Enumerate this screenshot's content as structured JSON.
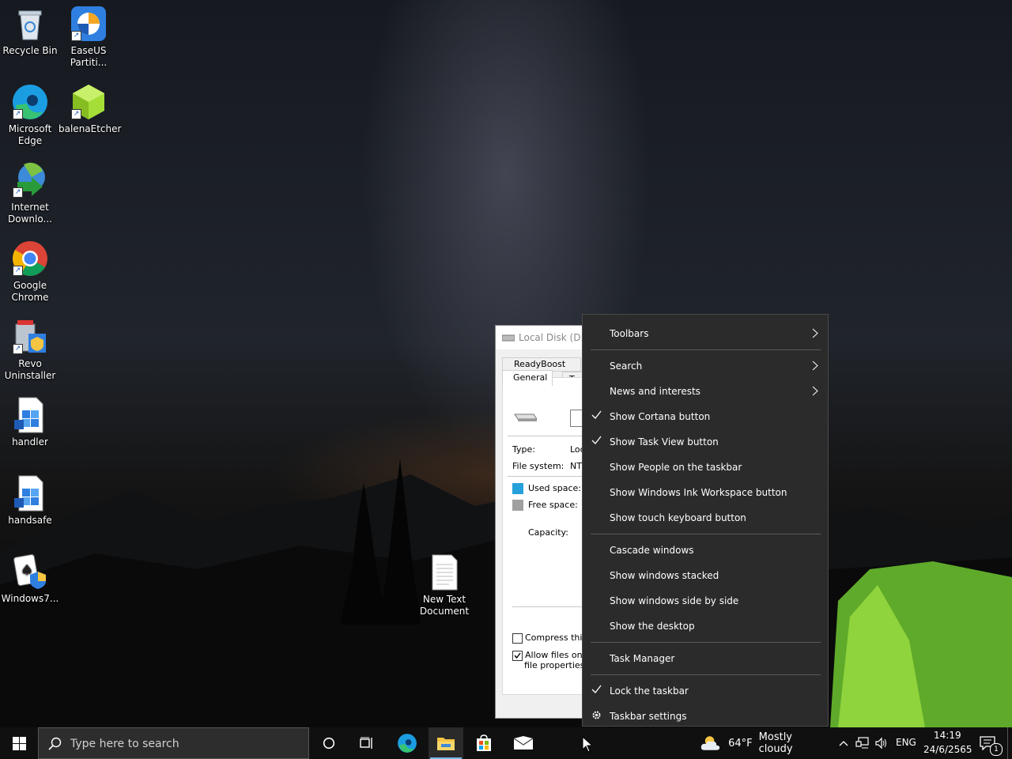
{
  "desktop": {
    "icons": [
      {
        "label": "Recycle Bin"
      },
      {
        "label": "EaseUS Partiti..."
      },
      {
        "label": "Microsoft Edge"
      },
      {
        "label": "balenaEtcher"
      },
      {
        "label": "Internet Downlo..."
      },
      {
        "label": "Google Chrome"
      },
      {
        "label": "Revo Uninstaller"
      },
      {
        "label": "handler"
      },
      {
        "label": "handsafe"
      },
      {
        "label": "Windows7..."
      },
      {
        "label": "New Text Document"
      }
    ]
  },
  "dialog": {
    "title": "Local Disk (D:) P",
    "tabs": [
      "ReadyBoost",
      "General",
      "Too"
    ],
    "type_label": "Type:",
    "type_value": "Loc",
    "fs_label": "File system:",
    "fs_value": "NT",
    "used_label": "Used space:",
    "free_label": "Free space:",
    "capacity_label": "Capacity:",
    "compress_label": "Compress this d",
    "allow_label_1": "Allow files on th",
    "allow_label_2": "file properties",
    "colors": {
      "used": "#26a0da",
      "free": "#a0a0a0"
    }
  },
  "context_menu": {
    "items": [
      {
        "label": "Toolbars",
        "checked": false,
        "submenu": true
      },
      {
        "label": "Search",
        "checked": false,
        "submenu": true
      },
      {
        "label": "News and interests",
        "checked": false,
        "submenu": true
      },
      {
        "label": "Show Cortana button",
        "checked": true,
        "submenu": false
      },
      {
        "label": "Show Task View button",
        "checked": true,
        "submenu": false
      },
      {
        "label": "Show People on the taskbar",
        "checked": false,
        "submenu": false
      },
      {
        "label": "Show Windows Ink Workspace button",
        "checked": false,
        "submenu": false
      },
      {
        "label": "Show touch keyboard button",
        "checked": false,
        "submenu": false
      },
      {
        "label": "Cascade windows",
        "checked": false,
        "submenu": false
      },
      {
        "label": "Show windows stacked",
        "checked": false,
        "submenu": false
      },
      {
        "label": "Show windows side by side",
        "checked": false,
        "submenu": false
      },
      {
        "label": "Show the desktop",
        "checked": false,
        "submenu": false
      },
      {
        "label": "Task Manager",
        "checked": false,
        "submenu": false
      },
      {
        "label": "Lock the taskbar",
        "checked": true,
        "submenu": false
      },
      {
        "label": "Taskbar settings",
        "checked": false,
        "submenu": false,
        "icon": "gear-icon"
      }
    ]
  },
  "taskbar": {
    "search_placeholder": "Type here to search",
    "apps": [
      "cortana-icon",
      "task-view-icon",
      "edge-icon",
      "file-explorer-icon",
      "store-icon",
      "mail-icon"
    ],
    "weather_temp": "64°F",
    "weather_text": "Mostly cloudy",
    "language": "ENG",
    "time": "14:19",
    "date": "24/6/2565",
    "notification_count": "1",
    "accent": "#76b9ed"
  }
}
